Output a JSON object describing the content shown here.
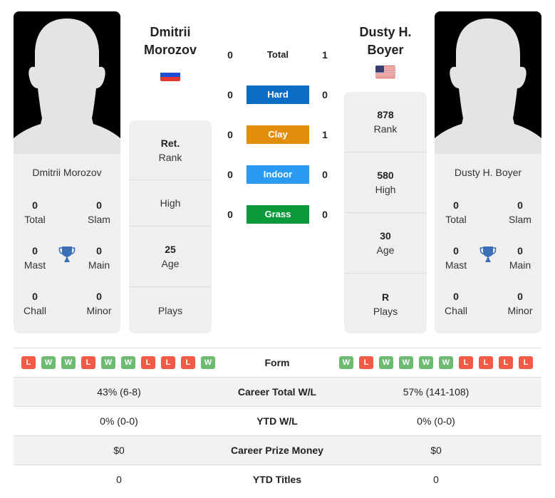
{
  "players": {
    "left": {
      "name": "Dmitrii Morozov",
      "name_line1": "Dmitrii",
      "name_line2": "Morozov",
      "country_flag": "russia-flag",
      "titles": {
        "total": {
          "value": "0",
          "label": "Total"
        },
        "slam": {
          "value": "0",
          "label": "Slam"
        },
        "mast": {
          "value": "0",
          "label": "Mast"
        },
        "main": {
          "value": "0",
          "label": "Main"
        },
        "chall": {
          "value": "0",
          "label": "Chall"
        },
        "minor": {
          "value": "0",
          "label": "Minor"
        }
      },
      "stats": {
        "rank": {
          "value": "Ret.",
          "label": "Rank"
        },
        "high": {
          "value": "",
          "label": "High"
        },
        "age": {
          "value": "25",
          "label": "Age"
        },
        "plays": {
          "value": "",
          "label": "Plays"
        }
      },
      "form": [
        "L",
        "W",
        "W",
        "L",
        "W",
        "W",
        "L",
        "L",
        "L",
        "W"
      ]
    },
    "right": {
      "name": "Dusty H. Boyer",
      "name_line1": "Dusty H.",
      "name_line2": "Boyer",
      "country_flag": "usa-flag",
      "titles": {
        "total": {
          "value": "0",
          "label": "Total"
        },
        "slam": {
          "value": "0",
          "label": "Slam"
        },
        "mast": {
          "value": "0",
          "label": "Mast"
        },
        "main": {
          "value": "0",
          "label": "Main"
        },
        "chall": {
          "value": "0",
          "label": "Chall"
        },
        "minor": {
          "value": "0",
          "label": "Minor"
        }
      },
      "stats": {
        "rank": {
          "value": "878",
          "label": "Rank"
        },
        "high": {
          "value": "580",
          "label": "High"
        },
        "age": {
          "value": "30",
          "label": "Age"
        },
        "plays": {
          "value": "R",
          "label": "Plays"
        }
      },
      "form": [
        "W",
        "L",
        "W",
        "W",
        "W",
        "W",
        "L",
        "L",
        "L",
        "L"
      ]
    }
  },
  "h2h": [
    {
      "surface": "Total",
      "left": "0",
      "right": "1",
      "color": ""
    },
    {
      "surface": "Hard",
      "left": "0",
      "right": "0",
      "color": "#0a6cc2"
    },
    {
      "surface": "Clay",
      "left": "0",
      "right": "1",
      "color": "#e08e0b"
    },
    {
      "surface": "Indoor",
      "left": "0",
      "right": "0",
      "color": "#2a9bf2"
    },
    {
      "surface": "Grass",
      "left": "0",
      "right": "0",
      "color": "#0a9a3c"
    }
  ],
  "form_label": "Form",
  "comparison": [
    {
      "label": "Career Total W/L",
      "left": "43% (6-8)",
      "right": "57% (141-108)"
    },
    {
      "label": "YTD W/L",
      "left": "0% (0-0)",
      "right": "0% (0-0)"
    },
    {
      "label": "Career Prize Money",
      "left": "$0",
      "right": "$0"
    },
    {
      "label": "YTD Titles",
      "left": "0",
      "right": "0"
    }
  ],
  "colors": {
    "win": "#6dbb72",
    "loss": "#ef5b45",
    "trophy": "#3a6fb5"
  }
}
